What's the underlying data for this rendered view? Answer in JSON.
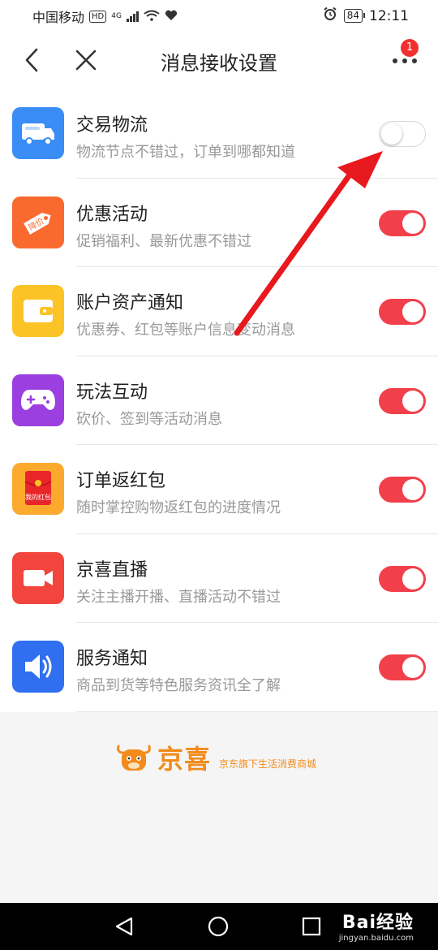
{
  "status_bar": {
    "carrier": "中国移动",
    "hd": "HD",
    "network": "4G",
    "battery": "84",
    "time": "12:11"
  },
  "header": {
    "title": "消息接收设置",
    "notification_count": "1"
  },
  "settings": [
    {
      "title": "交易物流",
      "desc": "物流节点不错过，订单到哪都知道",
      "enabled": false,
      "icon": "truck-icon",
      "color": "#3a8df5"
    },
    {
      "title": "优惠活动",
      "desc": "促销福利、最新优惠不错过",
      "enabled": true,
      "icon": "price-tag-icon",
      "color": "#fa6a2f"
    },
    {
      "title": "账户资产通知",
      "desc": "优惠券、红包等账户信息变动消息",
      "enabled": true,
      "icon": "wallet-icon",
      "color": "#fcc326"
    },
    {
      "title": "玩法互动",
      "desc": "砍价、签到等活动消息",
      "enabled": true,
      "icon": "gamepad-icon",
      "color": "#9b3fe0"
    },
    {
      "title": "订单返红包",
      "desc": "随时掌控购物返红包的进度情况",
      "enabled": true,
      "icon": "red-envelope-icon",
      "color": "#fbaa2e",
      "icon_text": "我的红包"
    },
    {
      "title": "京喜直播",
      "desc": "关注主播开播、直播活动不错过",
      "enabled": true,
      "icon": "video-camera-icon",
      "color": "#f2453d"
    },
    {
      "title": "服务通知",
      "desc": "商品到货等特色服务资讯全了解",
      "enabled": true,
      "icon": "speaker-icon",
      "color": "#2f6ff0"
    }
  ],
  "brand": {
    "name": "京喜",
    "slogan": "京东旗下生活消费商城"
  },
  "watermark": {
    "text": "Bai经验",
    "url": "jingyan.baidu.com"
  },
  "colors": {
    "toggle_on": "#f2404b",
    "brand_orange": "#f28b1c",
    "annotation_arrow": "#e8181f"
  }
}
